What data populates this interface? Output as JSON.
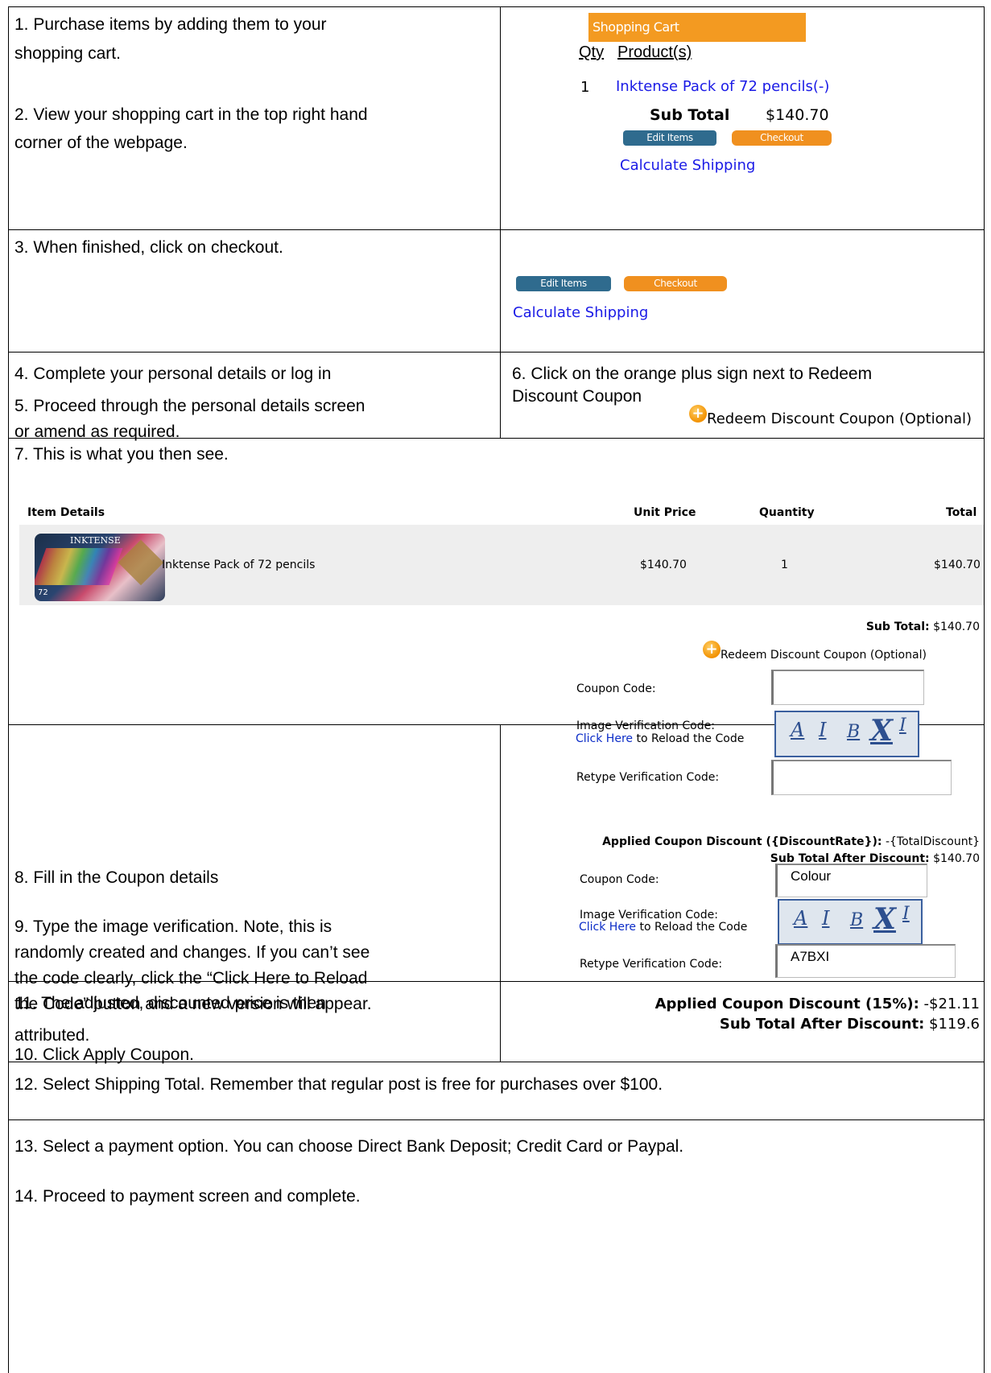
{
  "steps": {
    "s1": "1. Purchase items by adding them to your",
    "s1b": "shopping cart.",
    "s2": "2. View your shopping cart in the top right hand",
    "s2b": "corner of the webpage.",
    "s3": "3. When finished, click on checkout.",
    "s4": "4. Complete your personal details or log in",
    "s5": "5. Proceed through the personal details screen",
    "s5b": "or amend as required.",
    "s6": "6. Click on the orange plus sign next to Redeem",
    "s6b": "Discount Coupon",
    "s7": "7. This is what you then see.",
    "s8": "8. Fill in the Coupon details",
    "s9a": "9. Type the image verification.  Note, this is",
    "s9b": "randomly created and changes.  If you can’t see",
    "s9c": "the code clearly, click the “Click Here to Reload",
    "s9d": "the Code” button and a new version will appear.",
    "s10": "10. Click Apply Coupon.",
    "s11": "11. The adjusted, discounted price is then",
    "s11b": "attributed.",
    "s12": "12. Select Shipping Total.  Remember that regular post is free for purchases over $100.",
    "s13": "13.  Select a payment option.  You can choose Direct Bank Deposit; Credit Card or Paypal.",
    "s14": "14.  Proceed to payment screen and complete."
  },
  "cart": {
    "header": "Shopping Cart",
    "qty_label": "Qty",
    "product_label": "Product(s)",
    "item_qty": "1",
    "item_name": "Inktense Pack of 72 pencils(-)",
    "subtotal_label": "Sub Total",
    "subtotal_value": "$140.70",
    "edit_label": "Edit Items",
    "checkout_label": "Checkout",
    "calc_shipping": "Calculate Shipping"
  },
  "redeem_label": "Redeem Discount Coupon (Optional)",
  "order_table": {
    "headers": [
      "Item Details",
      "Unit Price",
      "Quantity",
      "Total"
    ],
    "row": {
      "name": "Inktense Pack of 72 pencils",
      "unit_price": "$140.70",
      "quantity": "1",
      "total": "$140.70",
      "image_text": "INKTENSE",
      "image_sub": "72"
    },
    "subtotal_label": "Sub Total:",
    "subtotal_value": "$140.70"
  },
  "coupon_form": {
    "coupon_label": "Coupon Code:",
    "image_label": "Image Verification Code:",
    "click_here": "Click Here",
    "reload_rest": " to Reload the Code",
    "retype_label": "Retype Verification Code:",
    "captcha_chars": [
      "A",
      "I",
      "B",
      "X",
      "I"
    ],
    "applied_label": "Applied Coupon Discount ({DiscountRate}):",
    "applied_value": "-{TotalDiscount}",
    "after_label": "Sub Total After Discount:",
    "after_value": "$140.70"
  },
  "filled_form": {
    "coupon_value": "Colour",
    "retype_value": "A7BXI"
  },
  "result": {
    "applied_label": "Applied Coupon Discount (15%):",
    "applied_value": "-$21.11",
    "after_label": "Sub Total After Discount:",
    "after_value": "$119.6"
  }
}
